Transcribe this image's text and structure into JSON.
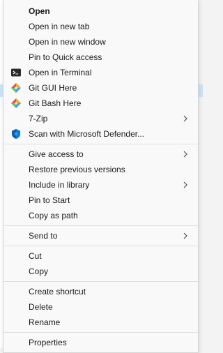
{
  "menu": {
    "groups": [
      {
        "items": [
          {
            "label": "Open",
            "bold": true
          },
          {
            "label": "Open in new tab"
          },
          {
            "label": "Open in new window"
          },
          {
            "label": "Pin to Quick access"
          },
          {
            "label": "Open in Terminal",
            "icon": "terminal-icon"
          },
          {
            "label": "Git GUI Here",
            "icon": "git-gui-icon"
          },
          {
            "label": "Git Bash Here",
            "icon": "git-bash-icon"
          },
          {
            "label": "7-Zip",
            "submenu": true
          },
          {
            "label": "Scan with Microsoft Defender...",
            "icon": "defender-shield-icon"
          }
        ]
      },
      {
        "items": [
          {
            "label": "Give access to",
            "submenu": true
          },
          {
            "label": "Restore previous versions"
          },
          {
            "label": "Include in library",
            "submenu": true
          },
          {
            "label": "Pin to Start"
          },
          {
            "label": "Copy as path"
          }
        ]
      },
      {
        "items": [
          {
            "label": "Send to",
            "submenu": true
          }
        ]
      },
      {
        "items": [
          {
            "label": "Cut"
          },
          {
            "label": "Copy"
          }
        ]
      },
      {
        "items": [
          {
            "label": "Create shortcut"
          },
          {
            "label": "Delete"
          },
          {
            "label": "Rename"
          }
        ]
      },
      {
        "items": [
          {
            "label": "Properties"
          }
        ]
      }
    ]
  },
  "colors": {
    "menu_bg": "#f9f9f9",
    "text": "#1a1a1a",
    "separator": "#e0e0e0",
    "selection": "#cce4f7",
    "defender_blue": "#0a5fb4"
  }
}
